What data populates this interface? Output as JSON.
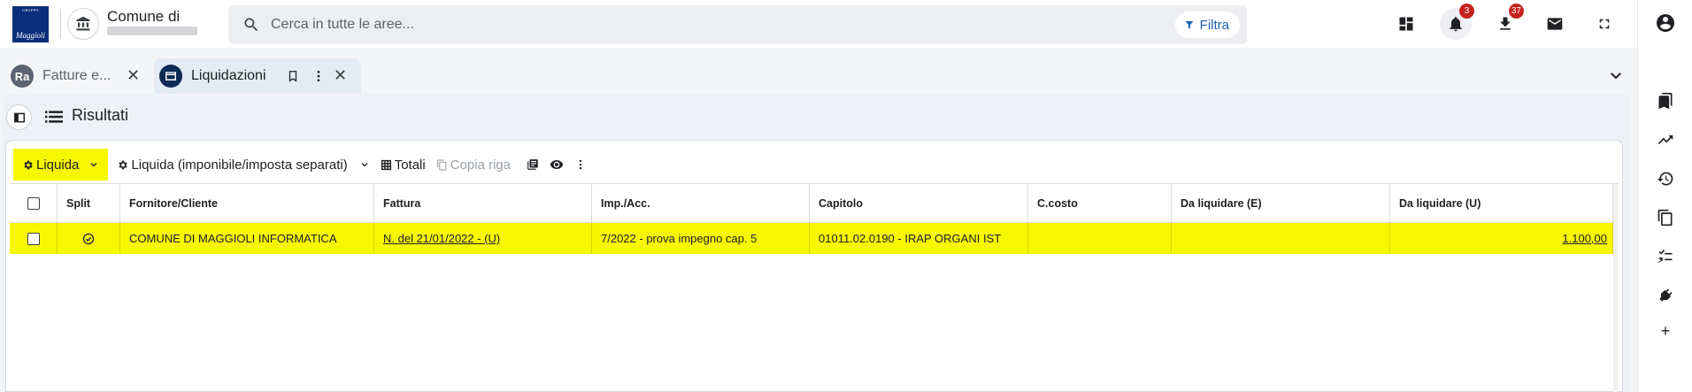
{
  "header": {
    "logo_top": "GRUPPO",
    "logo_text": "Maggioli",
    "institution_title": "Comune di",
    "search_placeholder": "Cerca in tutte le aree...",
    "filter_label": "Filtra",
    "notifications_count": "3",
    "downloads_count": "37"
  },
  "tabs": [
    {
      "label": "Fatture e...",
      "avatar": "Ra"
    },
    {
      "label": "Liquidazioni"
    }
  ],
  "panel": {
    "title": "Risultati"
  },
  "toolbar": {
    "liquida": "Liquida",
    "liquida_sep": "Liquida (imponibile/imposta separati)",
    "totali": "Totali",
    "copia_riga": "Copia riga"
  },
  "table": {
    "headers": [
      "Split",
      "Fornitore/Cliente",
      "Fattura",
      "Imp./Acc.",
      "Capitolo",
      "C.costo",
      "Da liquidare (E)",
      "Da liquidare (U)"
    ],
    "rows": [
      {
        "fornitore": "COMUNE DI MAGGIOLI INFORMATICA",
        "fattura": "N. del 21/01/2022 - (U)",
        "imp_acc": "7/2022 - prova impegno cap. 5",
        "capitolo": "01011.02.0190 - IRAP ORGANI IST",
        "c_costo": "",
        "da_liquidare_e": "",
        "da_liquidare_u": "1.100,00"
      }
    ]
  },
  "colors": {
    "highlight": "#f7f700",
    "accent": "#1a5fb4",
    "badge": "#c5221f"
  }
}
